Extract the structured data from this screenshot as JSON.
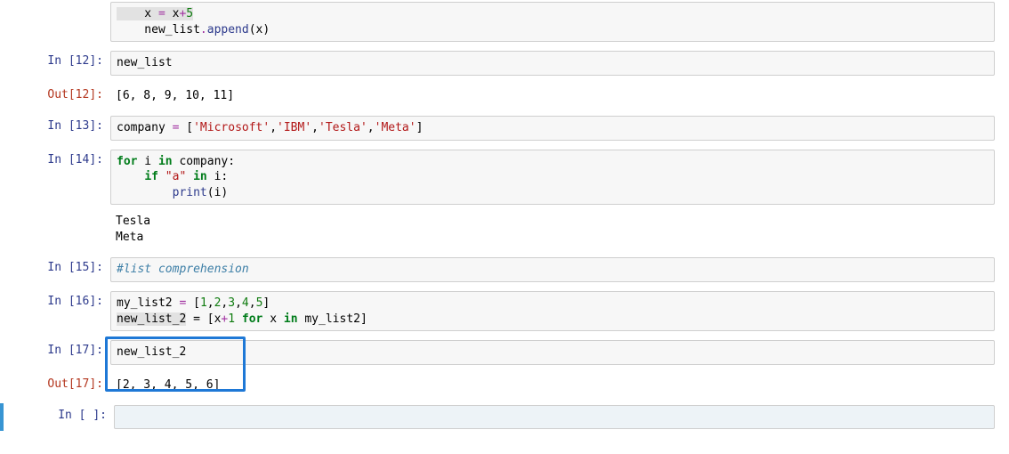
{
  "cells": {
    "top_partial": {
      "line1_pre": "    x ",
      "line1_op": "=",
      "line1_mid": " x",
      "line1_plus": "+",
      "line1_num": "5",
      "line2_pre": "    new_list",
      "line2_dot": ".",
      "line2_fn": "append",
      "line2_post": "(x)"
    },
    "c12": {
      "in_label": "In [12]:",
      "out_label": "Out[12]:",
      "code": "new_list",
      "out": "[6, 8, 9, 10, 11]"
    },
    "c13": {
      "in_label": "In [13]:",
      "pre": "company ",
      "eq": "=",
      "sp": " [",
      "s1": "'Microsoft'",
      "s2": "'IBM'",
      "s3": "'Tesla'",
      "s4": "'Meta'",
      "end": "]"
    },
    "c14": {
      "in_label": "In [14]:",
      "l1a": "for",
      "l1b": " i ",
      "l1c": "in",
      "l1d": " company:",
      "l2a": "    ",
      "l2b": "if",
      "l2c": " ",
      "l2d": "\"a\"",
      "l2e": " ",
      "l2f": "in",
      "l2g": " i:",
      "l3a": "        ",
      "l3b": "print",
      "l3c": "(i)",
      "out": "Tesla\nMeta"
    },
    "c15": {
      "in_label": "In [15]:",
      "comment": "#list comprehension"
    },
    "c16": {
      "in_label": "In [16]:",
      "l1_pre": "my_list2 ",
      "l1_eq": "=",
      "l1_sp": " [",
      "n1": "1",
      "n2": "2",
      "n3": "3",
      "n4": "4",
      "n5": "5",
      "l1_end": "]",
      "l2_pre": "new_list_2",
      "l2_eq": " = ",
      "l2_sp": "[x",
      "l2_plus": "+",
      "l2_n": "1",
      "l2_sp2": " ",
      "l2_for": "for",
      "l2_mid": " x ",
      "l2_in": "in",
      "l2_end": " my_list2]"
    },
    "c17": {
      "in_label": "In [17]:",
      "out_label": "Out[17]:",
      "code": "new_list_2",
      "out": "[2, 3, 4, 5, 6]"
    },
    "empty": {
      "in_label": "In [ ]:",
      "code": ""
    }
  }
}
